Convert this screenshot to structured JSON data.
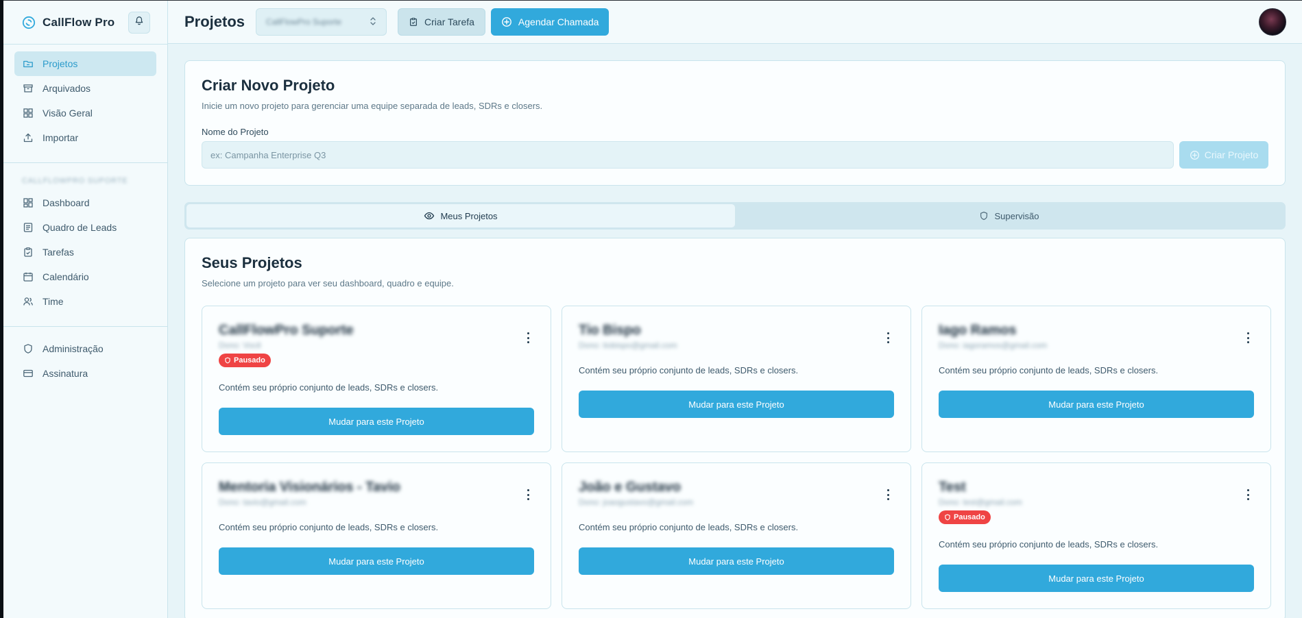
{
  "app": {
    "name": "CallFlow Pro"
  },
  "sidebar": {
    "primary": [
      {
        "label": "Projetos",
        "icon": "folder-icon",
        "active": true
      },
      {
        "label": "Arquivados",
        "icon": "archive-icon"
      },
      {
        "label": "Visão Geral",
        "icon": "grid-icon"
      },
      {
        "label": "Importar",
        "icon": "upload-icon"
      }
    ],
    "section_label": "CALLFLOWPRO SUPORTE",
    "project_nav": [
      {
        "label": "Dashboard",
        "icon": "dashboard-icon"
      },
      {
        "label": "Quadro de Leads",
        "icon": "board-icon"
      },
      {
        "label": "Tarefas",
        "icon": "clipboard-icon"
      },
      {
        "label": "Calendário",
        "icon": "calendar-icon"
      },
      {
        "label": "Time",
        "icon": "users-icon"
      }
    ],
    "admin_nav": [
      {
        "label": "Administração",
        "icon": "shield-icon"
      },
      {
        "label": "Assinatura",
        "icon": "credit-card-icon"
      }
    ]
  },
  "header": {
    "title": "Projetos",
    "project_select": "CallFlowPro Suporte",
    "create_task_label": "Criar Tarefa",
    "schedule_call_label": "Agendar Chamada"
  },
  "create_project": {
    "title": "Criar Novo Projeto",
    "subtitle": "Inicie um novo projeto para gerenciar uma equipe separada de leads, SDRs e closers.",
    "field_label": "Nome do Projeto",
    "placeholder": "ex: Campanha Enterprise Q3",
    "button_label": "Criar Projeto"
  },
  "tabs": [
    {
      "label": "Meus Projetos",
      "icon": "eye-icon",
      "active": true
    },
    {
      "label": "Supervisão",
      "icon": "shield-icon",
      "active": false
    }
  ],
  "projects_section": {
    "title": "Seus Projetos",
    "subtitle": "Selecione um projeto para ver seu dashboard, quadro e equipe.",
    "paused_label": "Pausado",
    "card_description": "Contém seu próprio conjunto de leads, SDRs e closers.",
    "switch_label": "Mudar para este Projeto"
  },
  "projects": [
    {
      "name": "CallFlowPro Suporte",
      "owner": "Dono: Você",
      "paused": true
    },
    {
      "name": "Tio Bispo",
      "owner": "Dono: tiobispo@gmail.com",
      "paused": false
    },
    {
      "name": "Iago Ramos",
      "owner": "Dono: iagoramos@gmail.com",
      "paused": false
    },
    {
      "name": "Mentoria Visionários - Tavio",
      "owner": "Dono: tavio@gmail.com",
      "paused": false
    },
    {
      "name": "João e Gustavo",
      "owner": "Dono: joaogustavo@gmail.com",
      "paused": false
    },
    {
      "name": "Test",
      "owner": "Dono: test@gmail.com",
      "paused": true
    }
  ],
  "colors": {
    "accent": "#31a9dc",
    "paused": "#ef4444",
    "background": "#e7f4f8"
  }
}
